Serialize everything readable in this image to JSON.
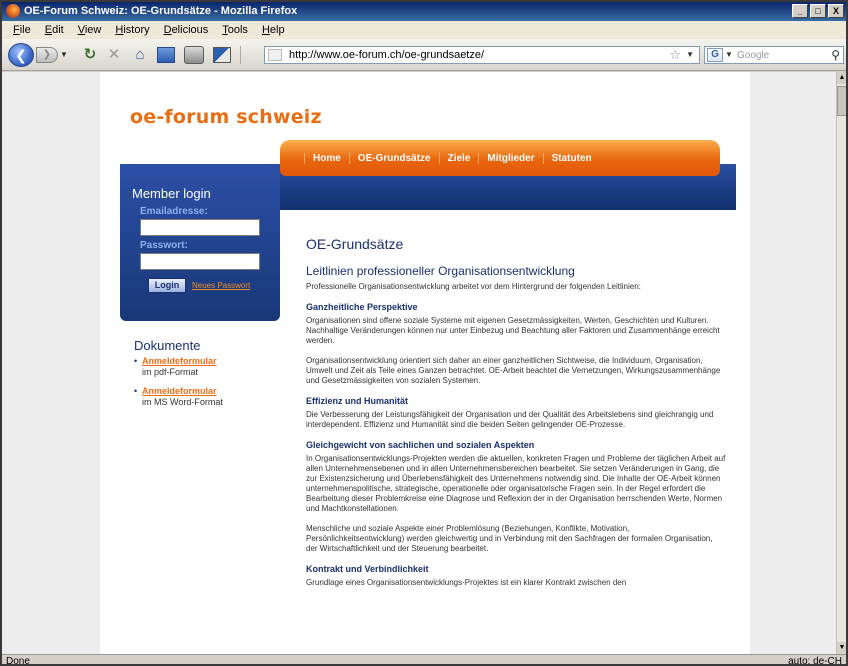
{
  "window": {
    "title": "OE-Forum Schweiz: OE-Grundsätze - Mozilla Firefox",
    "controls": [
      "_",
      "□",
      "X"
    ]
  },
  "menu": [
    "File",
    "Edit",
    "View",
    "History",
    "Delicious",
    "Tools",
    "Help"
  ],
  "toolbar": {
    "url": "http://www.oe-forum.ch/oe-grundsaetze/",
    "search_engine_label": "G",
    "search_placeholder": "Google"
  },
  "status": {
    "left": "Done",
    "right": "auto: de-CH"
  },
  "page": {
    "logo": "oe-forum schweiz",
    "nav": [
      "Home",
      "OE-Grundsätze",
      "Ziele",
      "Mitglieder",
      "Statuten"
    ],
    "login": {
      "title": "Member login",
      "email_label": "Emailadresse:",
      "password_label": "Passwort:",
      "button": "Login",
      "forgot": "Neues Passwort"
    },
    "documents": {
      "title": "Dokumente",
      "items": [
        {
          "link": "Anmeldeformular",
          "sub": "im pdf-Format"
        },
        {
          "link": "Anmeldeformular",
          "sub": "im MS Word-Format"
        }
      ]
    },
    "content": {
      "title": "OE-Grundsätze",
      "subtitle": "Leitlinien professioneller Organisationsentwicklung",
      "intro": "Professionelle Organisationsentwicklung arbeitet vor dem Hintergrund der folgenden Leitlinien:",
      "sections": [
        {
          "heading": "Ganzheitliche Perspektive",
          "paragraphs": [
            "Organisationen sind offene soziale Systeme mit eigenen Gesetzmässigkeiten, Werten, Geschichten und Kulturen. Nachhaltige Veränderungen können nur unter Einbezug und Beachtung aller Faktoren und Zusammenhänge erreicht werden.",
            "Organisationsentwicklung orientiert sich daher an einer ganzheitlichen Sichtweise, die Individuum, Organisation, Umwelt und Zeit als Teile eines Ganzen betrachtet. OE-Arbeit beachtet die Vernetzungen, Wirkungszusammenhänge und Gesetzmässigkeiten von sozialen Systemen."
          ]
        },
        {
          "heading": "Effizienz und Humanität",
          "paragraphs": [
            "Die Verbesserung der Leistungsfähigkeit der Organisation und der Qualität des Arbeitslebens sind gleichrangig und interdependent. Effizienz und Humanität sind die beiden Seiten gelingender OE-Prozesse."
          ]
        },
        {
          "heading": "Gleichgewicht von sachlichen und sozialen Aspekten",
          "paragraphs": [
            "In Organisationsentwicklungs-Projekten werden die aktuellen, konkreten Fragen und Probleme der täglichen Arbeit auf allen Unternehmensebenen und in allen Unternehmensbereichen bearbeitet. Sie setzen Veränderungen in Gang, die zur Existenzsicherung und Überlebensfähigkeit des Unternehmens notwendig sind. Die Inhalte der OE-Arbeit können unternehmenspolitische, strategische, operationelle oder organisatorische Fragen sein. In der Regel erfordert die Bearbeitung dieser Problemkreise eine Diagnose und Reflexion der in der Organisation herrschenden Werte, Normen und Machtkonstellationen.",
            "Menschliche und soziale Aspekte einer Problemlösung (Beziehungen, Konflikte, Motivation, Persönlichkeitsentwicklung) werden gleichwertig und in Verbindung mit den Sachfragen der formalen Organisation, der Wirtschaftlichkeit und der Steuerung bearbeitet."
          ]
        },
        {
          "heading": "Kontrakt und Verbindlichkeit",
          "paragraphs": [
            "Grundlage eines Organisationsentwicklungs-Projektes ist ein klarer Kontrakt zwischen den"
          ]
        }
      ]
    }
  }
}
